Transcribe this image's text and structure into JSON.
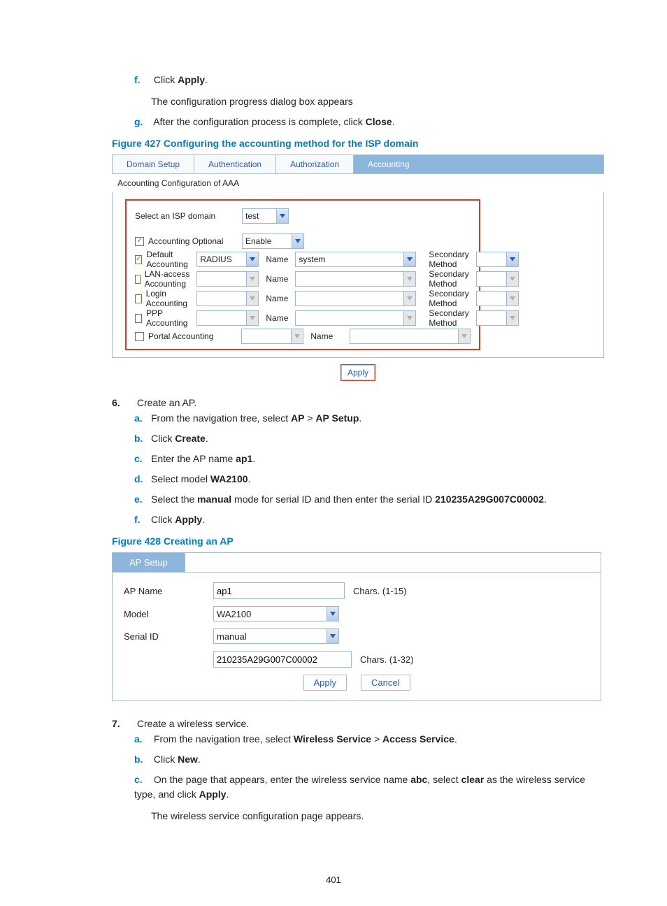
{
  "steps_top": {
    "f": {
      "marker": "f.",
      "text_pre": "Click ",
      "bold": "Apply",
      "text_post": ".",
      "after": "The configuration progress dialog box appears"
    },
    "g": {
      "marker": "g.",
      "text_pre": "After the configuration process is complete, click ",
      "bold": "Close",
      "text_post": "."
    }
  },
  "fig427_caption": "Figure 427 Configuring the accounting method for the ISP domain",
  "fig427": {
    "tabs": [
      "Domain Setup",
      "Authentication",
      "Authorization",
      "Accounting"
    ],
    "active_tab": 3,
    "subtitle": "Accounting Configuration of AAA",
    "isp_label": "Select an ISP domain",
    "isp_value": "test",
    "rows": [
      {
        "checked": true,
        "label": "Accounting Optional",
        "method": "Enable",
        "enabled": true,
        "showName": false,
        "showSecondary": false
      },
      {
        "checked": true,
        "label": "Default Accounting",
        "method": "RADIUS",
        "enabled": true,
        "showName": true,
        "name_val": "system",
        "showSecondary": true,
        "sec_enabled": true
      },
      {
        "checked": false,
        "label": "LAN-access Accounting",
        "method": "",
        "enabled": false,
        "showName": true,
        "name_val": "",
        "showSecondary": true,
        "sec_enabled": false
      },
      {
        "checked": false,
        "label": "Login Accounting",
        "method": "",
        "enabled": false,
        "showName": true,
        "name_val": "",
        "showSecondary": true,
        "sec_enabled": false
      },
      {
        "checked": false,
        "label": "PPP Accounting",
        "method": "",
        "enabled": false,
        "showName": true,
        "name_val": "",
        "showSecondary": true,
        "sec_enabled": false
      },
      {
        "checked": false,
        "label": "Portal Accounting",
        "method": "",
        "enabled": false,
        "showName": true,
        "name_val": "",
        "showSecondary": false
      }
    ],
    "name_label": "Name",
    "sec_label": "Secondary Method",
    "apply": "Apply"
  },
  "step6": {
    "num": "6.",
    "title": "Create an AP.",
    "items": [
      {
        "m": "a.",
        "pre": "From the navigation tree, select ",
        "b1": "AP",
        "mid": " > ",
        "b2": "AP Setup",
        "post": "."
      },
      {
        "m": "b.",
        "pre": "Click ",
        "b1": "Create",
        "post": "."
      },
      {
        "m": "c.",
        "pre": "Enter the AP name ",
        "b1": "ap1",
        "post": "."
      },
      {
        "m": "d.",
        "pre": "Select model ",
        "b1": "WA2100",
        "post": "."
      },
      {
        "m": "e.",
        "pre": "Select the ",
        "b1": "manual",
        "mid": " mode for serial ID and then enter the serial ID ",
        "b2": "210235A29G007C00002",
        "post": "."
      },
      {
        "m": "f.",
        "pre": "Click ",
        "b1": "Apply",
        "post": "."
      }
    ]
  },
  "fig428_caption": "Figure 428 Creating an AP",
  "fig428": {
    "tab": "AP Setup",
    "rows": {
      "apname": {
        "label": "AP Name",
        "value": "ap1",
        "hint": "Chars. (1-15)"
      },
      "model": {
        "label": "Model",
        "value": "WA2100"
      },
      "serial": {
        "label": "Serial ID",
        "value": "manual"
      },
      "serial2": {
        "value": "210235A29G007C00002",
        "hint": "Chars. (1-32)"
      }
    },
    "apply": "Apply",
    "cancel": "Cancel"
  },
  "step7": {
    "num": "7.",
    "title": "Create a wireless service.",
    "items": {
      "a": {
        "m": "a.",
        "pre": "From the navigation tree, select ",
        "b1": "Wireless Service",
        "mid": " > ",
        "b2": "Access Service",
        "post": "."
      },
      "b": {
        "m": "b.",
        "pre": "Click ",
        "b1": "New",
        "post": "."
      },
      "c": {
        "m": "c.",
        "pre": "On the page that appears, enter the wireless service name ",
        "b1": "abc",
        "mid": ", select ",
        "b2": "clear",
        "mid2": " as the wireless service type, and click ",
        "b3": "Apply",
        "post": "."
      }
    },
    "c_after": "The wireless service configuration page appears."
  },
  "pagenum": "401"
}
